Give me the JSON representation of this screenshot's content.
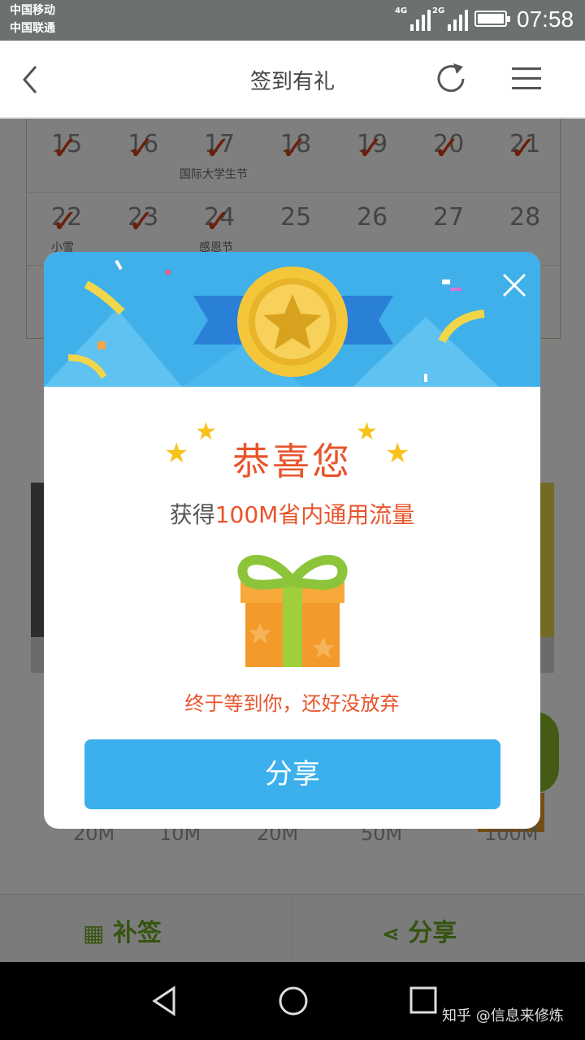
{
  "statusbar": {
    "carrier1": "中国移动",
    "carrier2": "中国联通",
    "net1": "4G",
    "net2": "2G",
    "time": "07:58"
  },
  "header": {
    "title": "签到有礼",
    "back_icon": "back-arrow-icon",
    "refresh_icon": "refresh-icon",
    "menu_icon": "menu-icon"
  },
  "calendar": {
    "rows": [
      {
        "days": [
          "15",
          "16",
          "17",
          "18",
          "19",
          "20",
          "21"
        ],
        "festivals": [
          "",
          "",
          "国际大学生节",
          "",
          "",
          "",
          ""
        ]
      },
      {
        "days": [
          "22",
          "23",
          "24",
          "25",
          "26",
          "27",
          "28"
        ],
        "festivals": [
          "小雪",
          "",
          "感恩节",
          "",
          "",
          "",
          ""
        ]
      }
    ]
  },
  "prizes": [
    "20M",
    "10M",
    "20M",
    "50M",
    "100M"
  ],
  "bottom_tabs": {
    "makeup": "补签",
    "share": "分享"
  },
  "modal": {
    "congrats": "恭喜您",
    "prize_prefix": "获得",
    "prize_value": "100M省内通用流量",
    "slogan": "终于等到你，还好没放弃",
    "share_button": "分享"
  },
  "watermark": "知乎 @信息来修炼",
  "colors": {
    "accent_blue": "#3bb0ec",
    "accent_orange": "#e8542b",
    "accent_green": "#6aa81e"
  }
}
